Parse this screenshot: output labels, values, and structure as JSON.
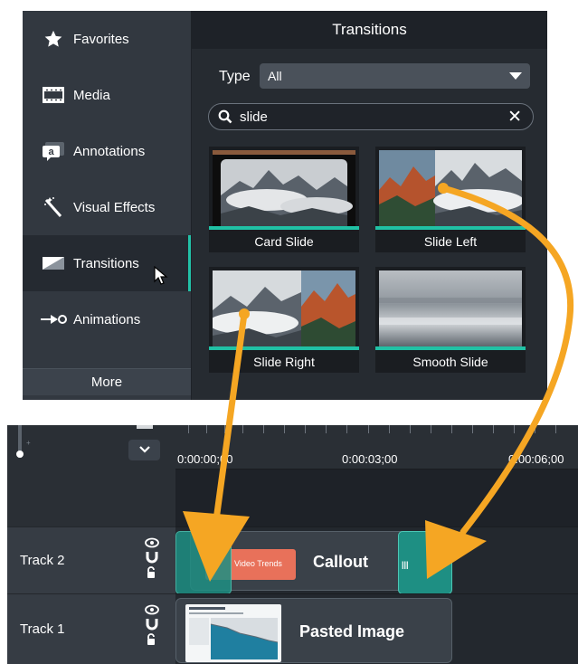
{
  "sidebar": {
    "items": [
      {
        "label": "Favorites",
        "icon": "star-icon"
      },
      {
        "label": "Media",
        "icon": "film-icon"
      },
      {
        "label": "Annotations",
        "icon": "annotation-icon"
      },
      {
        "label": "Visual Effects",
        "icon": "magic-wand-icon"
      },
      {
        "label": "Transitions",
        "icon": "transition-icon",
        "active": true
      },
      {
        "label": "Animations",
        "icon": "animation-icon"
      }
    ],
    "more_label": "More"
  },
  "panel": {
    "title": "Transitions",
    "type_label": "Type",
    "type_value": "All",
    "search_value": "slide",
    "clear_glyph": "✕"
  },
  "thumbnails": [
    {
      "caption": "Card Slide"
    },
    {
      "caption": "Slide Left"
    },
    {
      "caption": "Slide Right"
    },
    {
      "caption": "Smooth Slide"
    }
  ],
  "timeline": {
    "times": [
      "0:00:00;00",
      "0:00:03;00",
      "0:00:06;00"
    ],
    "tracks": [
      {
        "name": "Track 2",
        "clip_title": "Callout",
        "clip_inner_text": "Video Trends"
      },
      {
        "name": "Track 1",
        "clip_title": "Pasted Image"
      }
    ]
  },
  "colors": {
    "accent": "#22c1a7",
    "arrow": "#f5a623",
    "callout": "#e8715a"
  }
}
